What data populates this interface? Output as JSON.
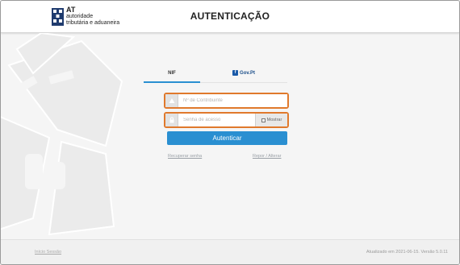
{
  "header": {
    "logo_title": "AT",
    "logo_line1": "autoridade",
    "logo_line2": "tributária e aduaneira",
    "page_title": "AUTENTICAÇÃO"
  },
  "tabs": [
    {
      "label": "NIF",
      "active": true
    },
    {
      "label": "Gov.Pt",
      "active": false,
      "badge": "f"
    }
  ],
  "form": {
    "nif_placeholder": "Nº de Contribuinte",
    "nif_value": "",
    "password_placeholder": "Senha de acesso",
    "password_value": "",
    "show_password_label": "Mostrar",
    "submit_label": "Autenticar",
    "recover_label": "Recuperar senha",
    "reset_label": "Repor / Alterar"
  },
  "footer": {
    "start_link": "Início Sessão",
    "version_text": "Atualizado em 2021-06-15. Versão 5.0.11"
  },
  "colors": {
    "accent": "#2a8fd1",
    "focus_border": "#e0792c",
    "background": "#f5f5f5"
  },
  "icons": {
    "nif_field": "user-icon",
    "password_field": "lock-icon"
  }
}
